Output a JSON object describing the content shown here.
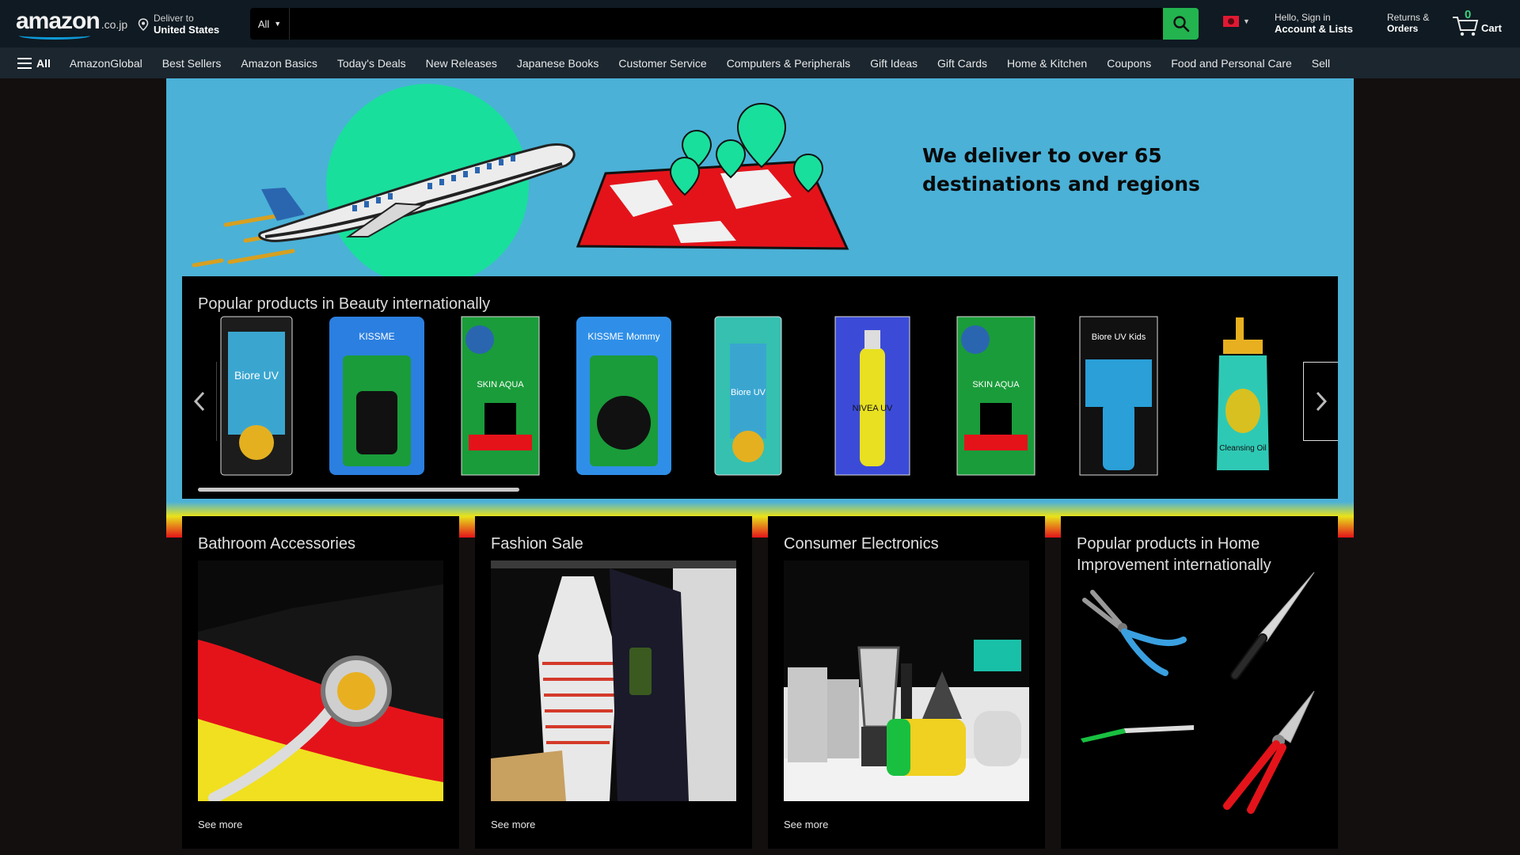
{
  "header": {
    "logo_text": "amazon",
    "logo_tld": ".co.jp",
    "deliver_line1": "Deliver to",
    "deliver_line2": "United States",
    "search_category": "All",
    "search_placeholder": "",
    "account_line1": "Hello, Sign in",
    "account_line2": "Account & Lists",
    "returns_line1": "Returns &",
    "returns_line2": "Orders",
    "cart_count": "0",
    "cart_label": "Cart"
  },
  "nav": {
    "all_label": "All",
    "items": [
      "AmazonGlobal",
      "Best Sellers",
      "Amazon Basics",
      "Today's Deals",
      "New Releases",
      "Japanese Books",
      "Customer Service",
      "Computers & Peripherals",
      "Gift Ideas",
      "Gift Cards",
      "Home & Kitchen",
      "Coupons",
      "Food and Personal Care",
      "Sell"
    ]
  },
  "hero": {
    "headline": "We deliver to over 65 destinations and regions"
  },
  "beauty": {
    "title": "Popular products in Beauty internationally",
    "products": [
      {
        "name": "Biore UV",
        "color": "#3aa6d0"
      },
      {
        "name": "KISSME",
        "color": "#2b7fe0"
      },
      {
        "name": "SKIN AQUA",
        "color": "#1a9c3a"
      },
      {
        "name": "KISSME Mommy",
        "color": "#2f8fe8"
      },
      {
        "name": "Biore UV",
        "color": "#35c0b0"
      },
      {
        "name": "NIVEA UV",
        "color": "#3b4bd8"
      },
      {
        "name": "SKIN AQUA",
        "color": "#1a9c3a"
      },
      {
        "name": "Biore UV Kids",
        "color": "#2a9fd8"
      },
      {
        "name": "Cleansing Oil",
        "color": "#2ec9b5"
      }
    ]
  },
  "cards": [
    {
      "title": "Bathroom Accessories",
      "see_more": "See more"
    },
    {
      "title": "Fashion Sale",
      "see_more": "See more"
    },
    {
      "title": "Consumer Electronics",
      "see_more": "See more"
    },
    {
      "title": "Popular products in Home Improvement internationally",
      "see_more": ""
    }
  ]
}
